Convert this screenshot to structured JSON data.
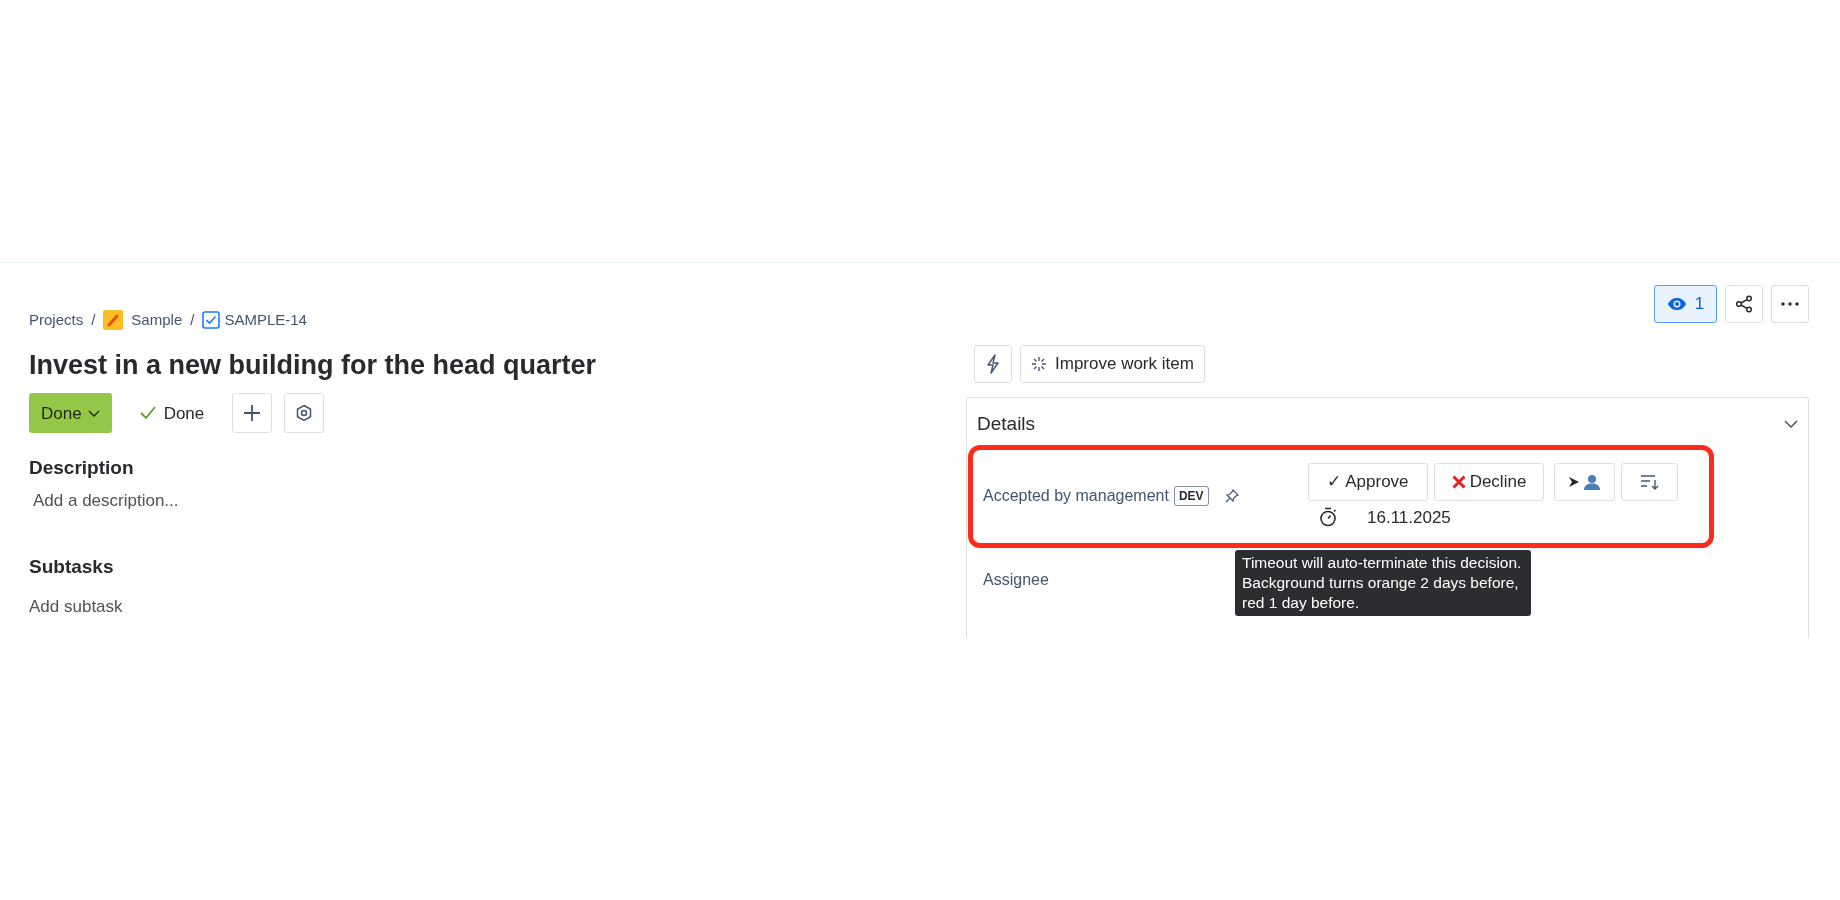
{
  "breadcrumb": [
    {
      "label": "Projects",
      "kind": "root",
      "separator": "/"
    },
    {
      "label": "Sample",
      "kind": "project",
      "separator": "/"
    },
    {
      "label": "SAMPLE-14",
      "kind": "task"
    }
  ],
  "title": "Invest in a new building for the head quarter",
  "status": {
    "button": "Done",
    "resolution": "Done"
  },
  "description": {
    "heading": "Description",
    "placeholder": "Add a description..."
  },
  "subtasks": {
    "heading": "Subtasks",
    "action": "Add subtask"
  },
  "watch": {
    "count": "1",
    "selected": true
  },
  "improve_button": "Improve work item",
  "details": {
    "heading": "Details",
    "expanded": true,
    "decision": {
      "label": "Accepted by management",
      "badge": "DEV",
      "highlighted": true,
      "approve": "✓ Approve",
      "decline": "Decline",
      "due_date": "16.11.2025"
    },
    "tooltip": "Timeout will auto-terminate this decision. Background turns orange 2 days before, red 1 day before.",
    "fields": [
      {
        "label": "Assignee"
      }
    ]
  }
}
